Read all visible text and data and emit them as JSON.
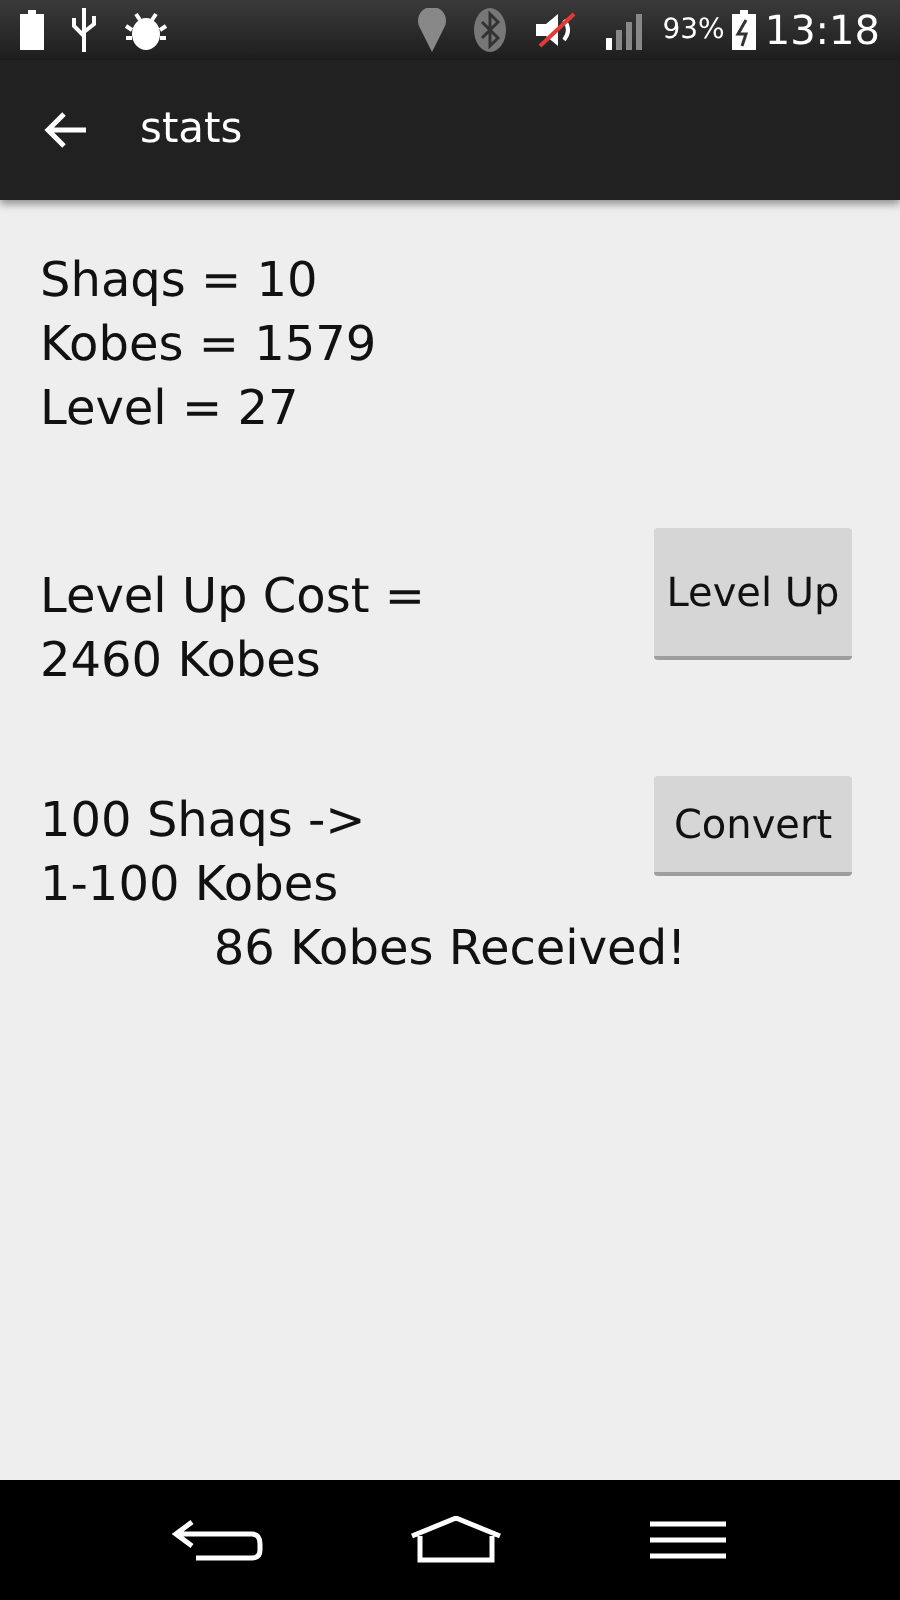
{
  "status_bar": {
    "battery_percent": "93%",
    "time": "13:18"
  },
  "app_bar": {
    "title": "stats"
  },
  "stats": [
    "Shaqs = 10",
    "Kobes = 1579",
    "Level = 27"
  ],
  "level_up": {
    "text": [
      "Level Up Cost =",
      "2460 Kobes"
    ],
    "button": "Level Up"
  },
  "convert": {
    "text": [
      "100 Shaqs ->",
      "1-100 Kobes"
    ],
    "button": "Convert",
    "result": "86 Kobes Received!"
  }
}
